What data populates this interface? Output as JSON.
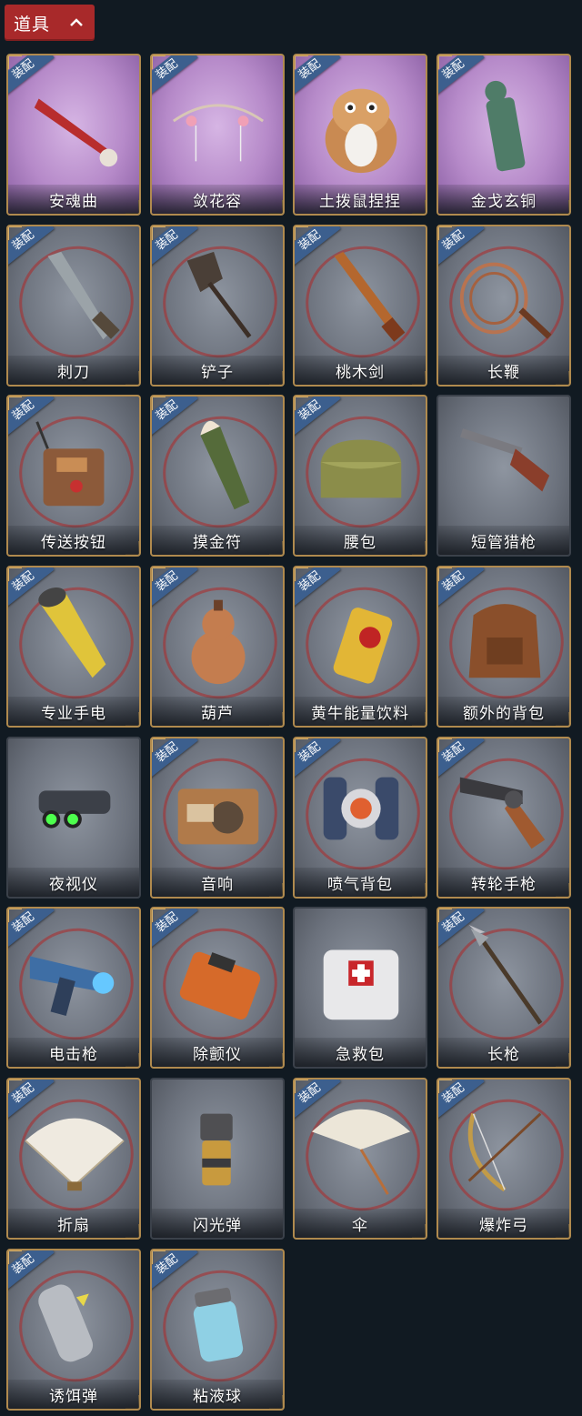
{
  "header": {
    "title": "道具"
  },
  "equip_badge_text": "装配",
  "items": [
    {
      "name": "安魂曲",
      "equipped": true
    },
    {
      "name": "敛花容",
      "equipped": true
    },
    {
      "name": "土拨鼠捏捏",
      "equipped": true
    },
    {
      "name": "金戈玄铜",
      "equipped": true
    },
    {
      "name": "刺刀",
      "equipped": true
    },
    {
      "name": "铲子",
      "equipped": true
    },
    {
      "name": "桃木剑",
      "equipped": true
    },
    {
      "name": "长鞭",
      "equipped": true
    },
    {
      "name": "传送按钮",
      "equipped": true
    },
    {
      "name": "摸金符",
      "equipped": true
    },
    {
      "name": "腰包",
      "equipped": true
    },
    {
      "name": "短管猎枪",
      "equipped": false
    },
    {
      "name": "专业手电",
      "equipped": true
    },
    {
      "name": "葫芦",
      "equipped": true
    },
    {
      "name": "黄牛能量饮料",
      "equipped": true
    },
    {
      "name": "额外的背包",
      "equipped": true
    },
    {
      "name": "夜视仪",
      "equipped": false
    },
    {
      "name": "音响",
      "equipped": true
    },
    {
      "name": "喷气背包",
      "equipped": true
    },
    {
      "name": "转轮手枪",
      "equipped": true
    },
    {
      "name": "电击枪",
      "equipped": true
    },
    {
      "name": "除颤仪",
      "equipped": true
    },
    {
      "name": "急救包",
      "equipped": false
    },
    {
      "name": "长枪",
      "equipped": true
    },
    {
      "name": "折扇",
      "equipped": true
    },
    {
      "name": "闪光弹",
      "equipped": false
    },
    {
      "name": "伞",
      "equipped": true
    },
    {
      "name": "爆炸弓",
      "equipped": true
    },
    {
      "name": "诱饵弹",
      "equipped": true
    },
    {
      "name": "粘液球",
      "equipped": true
    }
  ]
}
